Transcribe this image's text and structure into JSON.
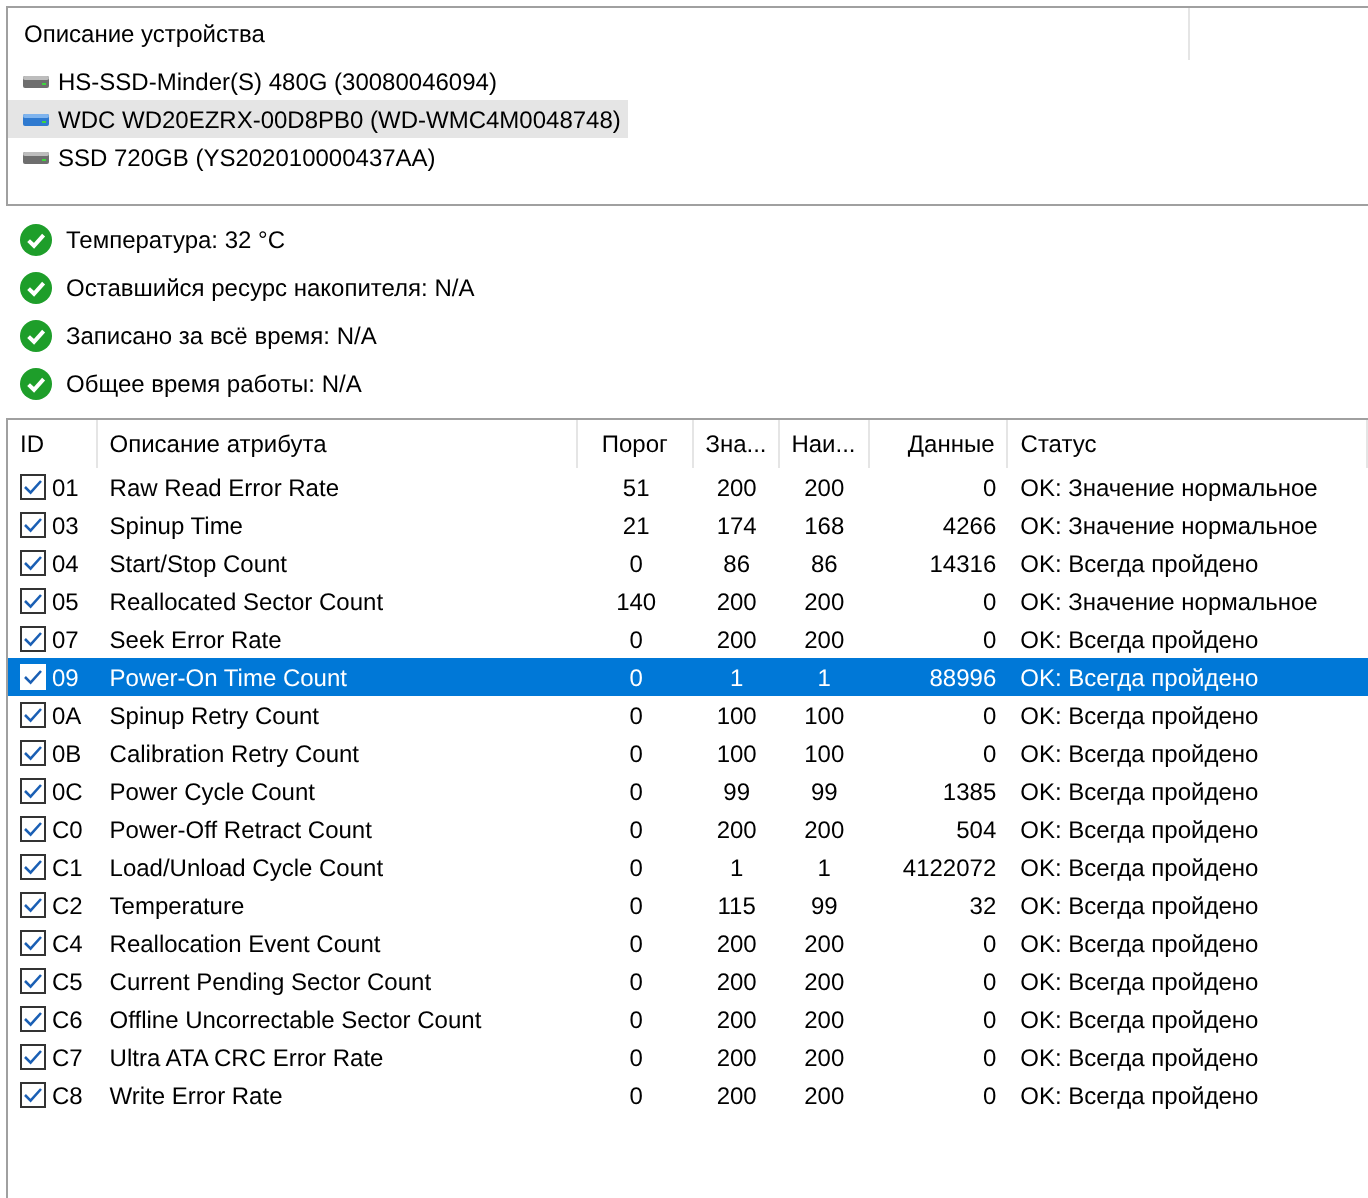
{
  "devices": {
    "header": "Описание устройства",
    "items": [
      {
        "label": "HS-SSD-Minder(S) 480G (30080046094)",
        "selected": false
      },
      {
        "label": "WDC WD20EZRX-00D8PB0 (WD-WMC4M0048748)",
        "selected": true
      },
      {
        "label": "SSD 720GB (YS202010000437AA)",
        "selected": false
      }
    ]
  },
  "health": [
    {
      "text": "Температура: 32 °C",
      "ok": true
    },
    {
      "text": "Оставшийся ресурс накопителя: N/A",
      "ok": true
    },
    {
      "text": "Записано за всё время: N/A",
      "ok": true
    },
    {
      "text": "Общее время работы: N/A",
      "ok": true
    }
  ],
  "table": {
    "columns": [
      "ID",
      "Описание атрибута",
      "Порог",
      "Зна...",
      "Наи...",
      "Данные",
      "Статус"
    ],
    "rows": [
      {
        "checked": true,
        "selected": false,
        "cells": [
          "01",
          "Raw Read Error Rate",
          "51",
          "200",
          "200",
          "0",
          "OK: Значение нормальное"
        ]
      },
      {
        "checked": true,
        "selected": false,
        "cells": [
          "03",
          "Spinup Time",
          "21",
          "174",
          "168",
          "4266",
          "OK: Значение нормальное"
        ]
      },
      {
        "checked": true,
        "selected": false,
        "cells": [
          "04",
          "Start/Stop Count",
          "0",
          "86",
          "86",
          "14316",
          "OK: Всегда пройдено"
        ]
      },
      {
        "checked": true,
        "selected": false,
        "cells": [
          "05",
          "Reallocated Sector Count",
          "140",
          "200",
          "200",
          "0",
          "OK: Значение нормальное"
        ]
      },
      {
        "checked": true,
        "selected": false,
        "cells": [
          "07",
          "Seek Error Rate",
          "0",
          "200",
          "200",
          "0",
          "OK: Всегда пройдено"
        ]
      },
      {
        "checked": true,
        "selected": true,
        "cells": [
          "09",
          "Power-On Time Count",
          "0",
          "1",
          "1",
          "88996",
          "OK: Всегда пройдено"
        ]
      },
      {
        "checked": true,
        "selected": false,
        "cells": [
          "0A",
          "Spinup Retry Count",
          "0",
          "100",
          "100",
          "0",
          "OK: Всегда пройдено"
        ]
      },
      {
        "checked": true,
        "selected": false,
        "cells": [
          "0B",
          "Calibration Retry Count",
          "0",
          "100",
          "100",
          "0",
          "OK: Всегда пройдено"
        ]
      },
      {
        "checked": true,
        "selected": false,
        "cells": [
          "0C",
          "Power Cycle Count",
          "0",
          "99",
          "99",
          "1385",
          "OK: Всегда пройдено"
        ]
      },
      {
        "checked": true,
        "selected": false,
        "cells": [
          "C0",
          "Power-Off Retract Count",
          "0",
          "200",
          "200",
          "504",
          "OK: Всегда пройдено"
        ]
      },
      {
        "checked": true,
        "selected": false,
        "cells": [
          "C1",
          "Load/Unload Cycle Count",
          "0",
          "1",
          "1",
          "4122072",
          "OK: Всегда пройдено"
        ]
      },
      {
        "checked": true,
        "selected": false,
        "cells": [
          "C2",
          "Temperature",
          "0",
          "115",
          "99",
          "32",
          "OK: Всегда пройдено"
        ]
      },
      {
        "checked": true,
        "selected": false,
        "cells": [
          "C4",
          "Reallocation Event Count",
          "0",
          "200",
          "200",
          "0",
          "OK: Всегда пройдено"
        ]
      },
      {
        "checked": true,
        "selected": false,
        "cells": [
          "C5",
          "Current Pending Sector Count",
          "0",
          "200",
          "200",
          "0",
          "OK: Всегда пройдено"
        ]
      },
      {
        "checked": true,
        "selected": false,
        "cells": [
          "C6",
          "Offline Uncorrectable Sector Count",
          "0",
          "200",
          "200",
          "0",
          "OK: Всегда пройдено"
        ]
      },
      {
        "checked": true,
        "selected": false,
        "cells": [
          "C7",
          "Ultra ATA CRC Error Rate",
          "0",
          "200",
          "200",
          "0",
          "OK: Всегда пройдено"
        ]
      },
      {
        "checked": true,
        "selected": false,
        "cells": [
          "C8",
          "Write Error Rate",
          "0",
          "200",
          "200",
          "0",
          "OK: Всегда пройдено"
        ]
      }
    ]
  }
}
